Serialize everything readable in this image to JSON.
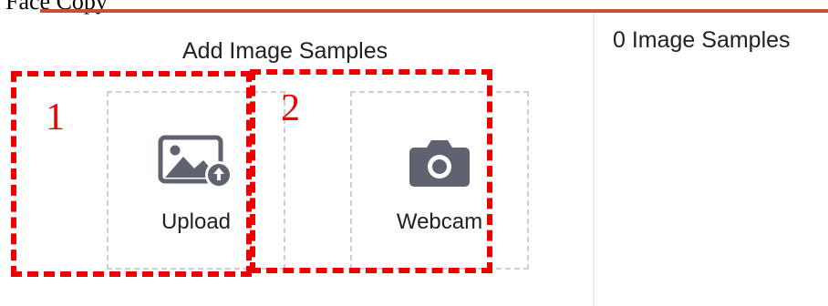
{
  "header": {
    "clipped_title": "Face Copy"
  },
  "add_samples": {
    "title": "Add Image Samples",
    "sources": [
      {
        "label": "Upload",
        "icon": "image-upload-icon"
      },
      {
        "label": "Webcam",
        "icon": "camera-icon"
      }
    ]
  },
  "samples_panel": {
    "count_text": "0 Image Samples"
  },
  "annotations": [
    {
      "number": "1",
      "color": "#ee0000"
    },
    {
      "number": "2",
      "color": "#ee0000"
    }
  ],
  "colors": {
    "accent_rule": "#c8503b",
    "icon_gray": "#5f6370",
    "tile_border": "#cfcfcf"
  }
}
